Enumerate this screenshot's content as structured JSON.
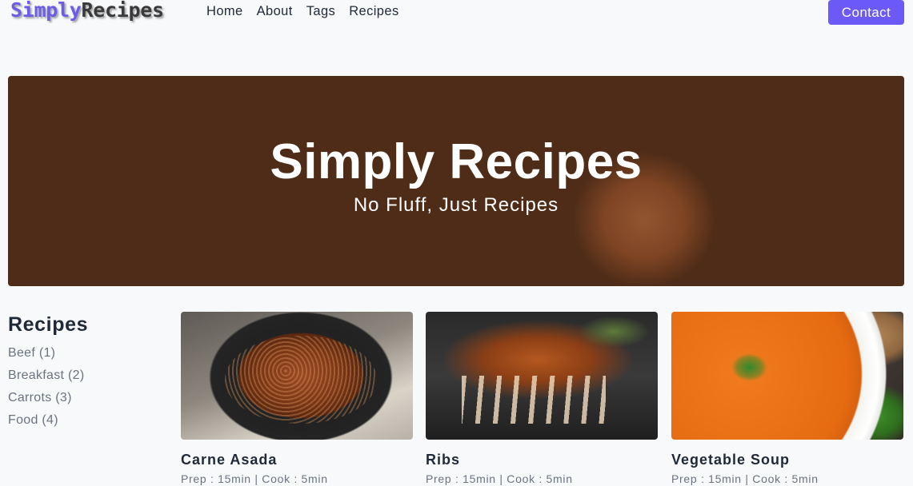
{
  "header": {
    "logo_part1": "Simply",
    "logo_part2": "Recipes",
    "nav": [
      "Home",
      "About",
      "Tags",
      "Recipes"
    ],
    "contact_label": "Contact",
    "accent_color": "#6b5af7"
  },
  "hero": {
    "title": "Simply Recipes",
    "subtitle": "No Fluff, Just Recipes"
  },
  "sidebar": {
    "title": "Recipes",
    "tags": [
      "Beef (1)",
      "Breakfast (2)",
      "Carrots (3)",
      "Food (4)"
    ]
  },
  "recipes": [
    {
      "name": "Carne Asada",
      "meta": "Prep : 15min | Cook : 5min",
      "image": "carne-asada-photo"
    },
    {
      "name": "Ribs",
      "meta": "Prep : 15min | Cook : 5min",
      "image": "ribs-photo"
    },
    {
      "name": "Vegetable Soup",
      "meta": "Prep : 15min | Cook : 5min",
      "image": "vegetable-soup-photo"
    }
  ]
}
